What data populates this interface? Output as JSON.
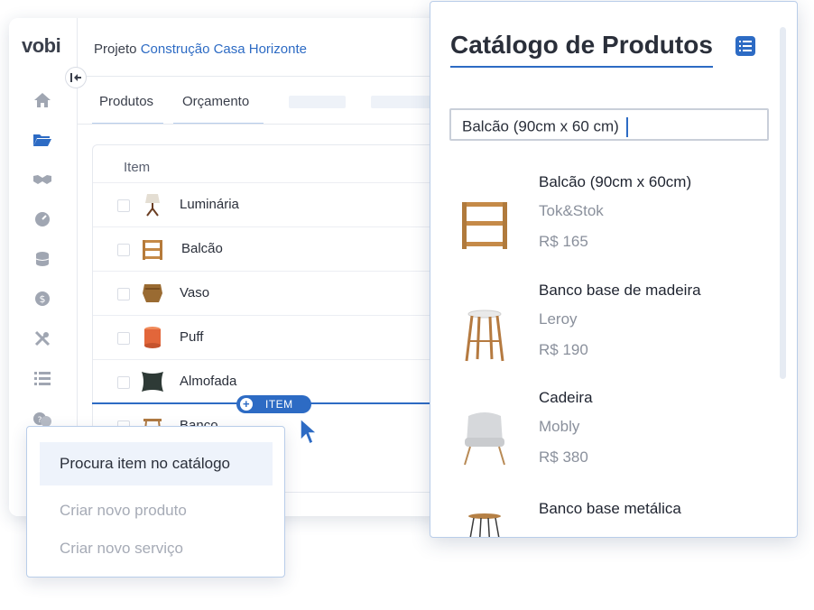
{
  "app": {
    "logo": "vobi",
    "header": {
      "prefix": "Projeto",
      "project_name": "Construção Casa Horizonte"
    },
    "tabs": [
      {
        "label": "Produtos"
      },
      {
        "label": "Orçamento"
      }
    ],
    "table": {
      "column_header": "Item",
      "rows": [
        {
          "name": "Luminária"
        },
        {
          "name": "Balcão"
        },
        {
          "name": "Vaso"
        },
        {
          "name": "Puff"
        },
        {
          "name": "Almofada"
        },
        {
          "name": "Banco"
        }
      ]
    },
    "insert_button_label": "ITEM",
    "add_menu": [
      {
        "label": "Procura item no catálogo"
      },
      {
        "label": "Criar novo produto"
      },
      {
        "label": "Criar novo serviço"
      }
    ],
    "sidebar_icons": [
      "home-icon",
      "folder-icon",
      "handshake-icon",
      "gauge-icon",
      "database-icon",
      "dollar-icon",
      "tools-icon",
      "list-icon",
      "help-chat-icon"
    ]
  },
  "catalog": {
    "title": "Catálogo de Produtos",
    "search_value": "Balcão (90cm x 60 cm)",
    "products": [
      {
        "name": "Balcão (90cm x 60cm)",
        "store": "Tok&Stok",
        "price": "R$ 165"
      },
      {
        "name": "Banco base de madeira",
        "store": "Leroy",
        "price": "R$ 190"
      },
      {
        "name": "Cadeira",
        "store": "Mobly",
        "price": "R$ 380"
      },
      {
        "name": "Banco base metálica",
        "store": "",
        "price": ""
      }
    ]
  },
  "colors": {
    "accent": "#2d6bc4",
    "muted_text": "#a6abb6"
  }
}
